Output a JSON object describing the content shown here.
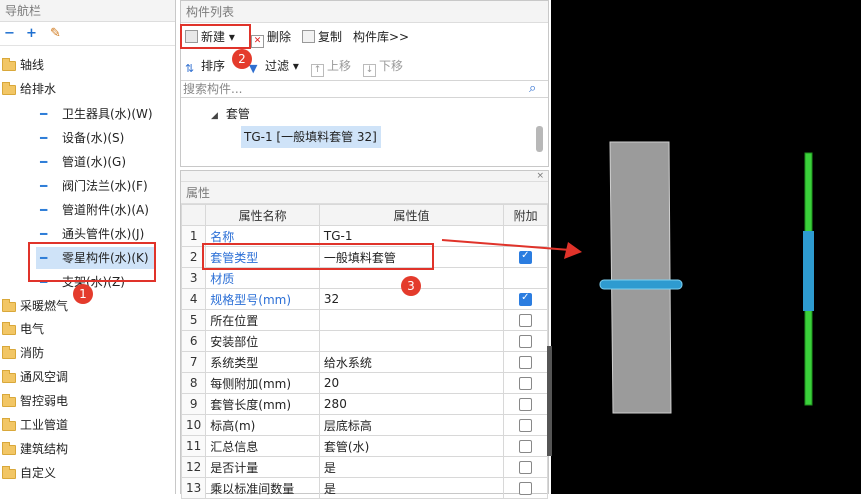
{
  "nav": {
    "title": "导航栏",
    "toolbar": [
      "−",
      "+",
      "✎"
    ],
    "items": [
      {
        "label": "轴线",
        "type": "folder"
      },
      {
        "label": "给排水",
        "type": "folder-open"
      },
      {
        "label": "卫生器具(水)(W)",
        "type": "child"
      },
      {
        "label": "设备(水)(S)",
        "type": "child"
      },
      {
        "label": "管道(水)(G)",
        "type": "child"
      },
      {
        "label": "阀门法兰(水)(F)",
        "type": "child"
      },
      {
        "label": "管道附件(水)(A)",
        "type": "child"
      },
      {
        "label": "通头管件(水)(J)",
        "type": "child"
      },
      {
        "label": "零星构件(水)(K)",
        "type": "child-selected"
      },
      {
        "label": "支架(水)(Z)",
        "type": "child"
      },
      {
        "label": "采暖燃气",
        "type": "folder"
      },
      {
        "label": "电气",
        "type": "folder"
      },
      {
        "label": "消防",
        "type": "folder"
      },
      {
        "label": "通风空调",
        "type": "folder"
      },
      {
        "label": "智控弱电",
        "type": "folder"
      },
      {
        "label": "工业管道",
        "type": "folder"
      },
      {
        "label": "建筑结构",
        "type": "folder"
      },
      {
        "label": "自定义",
        "type": "folder"
      }
    ]
  },
  "list": {
    "title": "构件列表",
    "toolbar1": {
      "new": "新建",
      "delete": "删除",
      "copy": "复制",
      "library": "构件库>>"
    },
    "toolbar2": {
      "sort": "排序",
      "filter": "过滤",
      "up": "上移",
      "down": "下移"
    },
    "search_placeholder": "搜索构件...",
    "tree_parent": "套管",
    "tree_child": "TG-1 [一般填料套管 32]"
  },
  "props": {
    "title": "属性",
    "headers": [
      "属性名称",
      "属性值",
      "附加"
    ],
    "rows": [
      {
        "n": "1",
        "name": "名称",
        "value": "TG-1",
        "blue": true,
        "check": "none"
      },
      {
        "n": "2",
        "name": "套管类型",
        "value": "一般填料套管",
        "blue": true,
        "check": "on"
      },
      {
        "n": "3",
        "name": "材质",
        "value": "",
        "blue": true,
        "check": "none"
      },
      {
        "n": "4",
        "name": "规格型号(mm)",
        "value": "32",
        "blue": true,
        "check": "on"
      },
      {
        "n": "5",
        "name": "所在位置",
        "value": "",
        "blue": false,
        "check": "off"
      },
      {
        "n": "6",
        "name": "安装部位",
        "value": "",
        "blue": false,
        "check": "off"
      },
      {
        "n": "7",
        "name": "系统类型",
        "value": "给水系统",
        "blue": false,
        "check": "off"
      },
      {
        "n": "8",
        "name": "每侧附加(mm)",
        "value": "20",
        "blue": false,
        "check": "off"
      },
      {
        "n": "9",
        "name": "套管长度(mm)",
        "value": "280",
        "blue": false,
        "check": "off"
      },
      {
        "n": "10",
        "name": "标高(m)",
        "value": "层底标高",
        "blue": false,
        "check": "off"
      },
      {
        "n": "11",
        "name": "汇总信息",
        "value": "套管(水)",
        "blue": false,
        "check": "off"
      },
      {
        "n": "12",
        "name": "是否计量",
        "value": "是",
        "blue": false,
        "check": "off"
      },
      {
        "n": "13",
        "name": "乘以标准间数量",
        "value": "是",
        "blue": false,
        "check": "off"
      }
    ]
  },
  "badges": [
    "1",
    "2",
    "3"
  ],
  "colors": {
    "accent": "#e0332a",
    "selection": "#cfe3f8",
    "pipe": "#2e9bd0",
    "wall": "#9a9a9a",
    "green_pipe": "#3bd03b"
  }
}
